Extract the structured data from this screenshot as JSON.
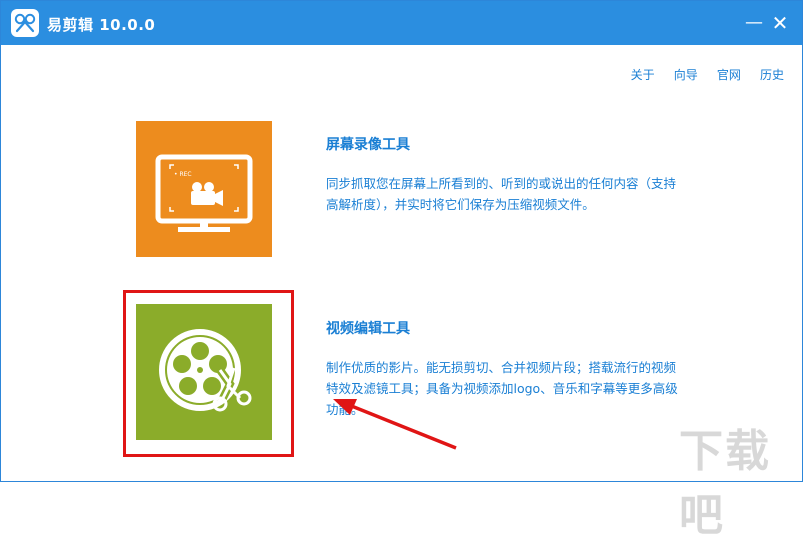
{
  "window": {
    "title": "易剪辑 10.0.0",
    "minimize_glyph": "—",
    "close_glyph": "✕",
    "icon": "app-logo-icon",
    "accent_color": "#2b8ee0"
  },
  "topnav": {
    "items": [
      "关于",
      "向导",
      "官网",
      "历史"
    ]
  },
  "tools": [
    {
      "title": "屏幕录像工具",
      "description": "同步抓取您在屏幕上所看到的、听到的或说出的任何内容（支持高解析度），并实时将它们保存为压缩视频文件。",
      "icon": "screen-record-icon",
      "tile_color": "#ed8c1e",
      "icon_text": "• REC"
    },
    {
      "title": "视频编辑工具",
      "description": "制作优质的影片。能无损剪切、合并视频片段；搭载流行的视频特效及滤镜工具；具备为视频添加logo、音乐和字幕等更多高级功能。",
      "icon": "film-reel-scissors-icon",
      "tile_color": "#8bac2a"
    }
  ],
  "annotation": {
    "highlight_color": "#e01515"
  },
  "watermark": {
    "text": "下载吧"
  }
}
